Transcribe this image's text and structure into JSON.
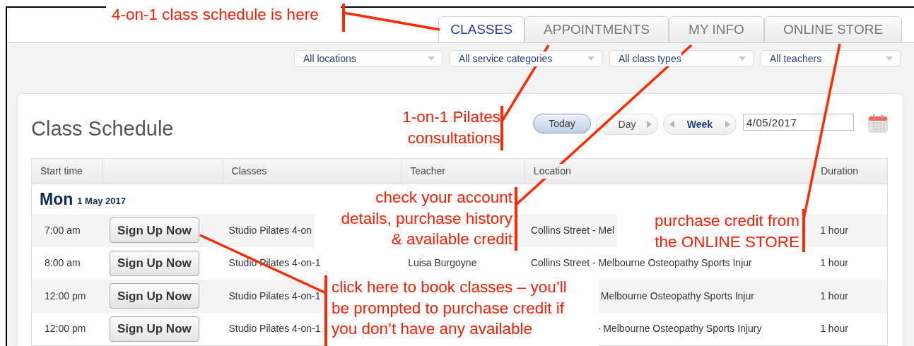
{
  "annotations": [
    {
      "text": "4-on-1 class schedule is here"
    },
    {
      "text": "1-on-1 Pilates\nconsultations"
    },
    {
      "text": "check your account\ndetails, purchase history\n& available credit"
    },
    {
      "text": "click here to book classes – you’ll\nbe prompted to purchase credit if\nyou don’t have any available"
    },
    {
      "text": "purchase credit from\nthe ONLINE STORE"
    }
  ],
  "tabs": [
    {
      "label": "CLASSES",
      "selected": true
    },
    {
      "label": "APPOINTMENTS",
      "selected": false
    },
    {
      "label": "MY INFO",
      "selected": false
    },
    {
      "label": "ONLINE STORE",
      "selected": false
    }
  ],
  "filters": [
    {
      "value": "All locations"
    },
    {
      "value": "All service categories"
    },
    {
      "value": "All class types"
    },
    {
      "value": "All teachers"
    }
  ],
  "page_title": "Class Schedule",
  "today_button": "Today",
  "view_buttons": [
    {
      "label": "Day",
      "selected": false
    },
    {
      "label": "Week",
      "selected": true
    }
  ],
  "date_field": {
    "value": "4/05/2017"
  },
  "table": {
    "columns": [
      "Start time",
      "Classes",
      "Teacher",
      "Location",
      "Duration"
    ],
    "days": [
      {
        "day": "Mon",
        "date": "1 May 2017",
        "rows": [
          {
            "start_time": "7:00 am",
            "button": "Sign Up Now",
            "class": "Studio Pilates 4-on",
            "location": "Collins Street - Mel",
            "duration": "1 hour"
          },
          {
            "start_time": "8:00 am",
            "button": "Sign Up Now",
            "class": "Studio Pilates 4-on-1",
            "teacher": "Luisa Burgoyne",
            "location": "Collins Street - Melbourne Osteopathy Sports Injur",
            "duration": "1 hour"
          },
          {
            "start_time": "12:00 pm",
            "button": "Sign Up Now",
            "class": "Studio Pilates 4-on-1",
            "location": "Melbourne Osteopathy Sports Injur",
            "duration": "1 hour"
          },
          {
            "start_time": "12:00 pm",
            "button": "Sign Up Now",
            "class": "Studio Pilates 4-on-1",
            "location": "- Melbourne Osteopathy Sports Injury",
            "duration": "1 hour"
          }
        ]
      }
    ]
  }
}
